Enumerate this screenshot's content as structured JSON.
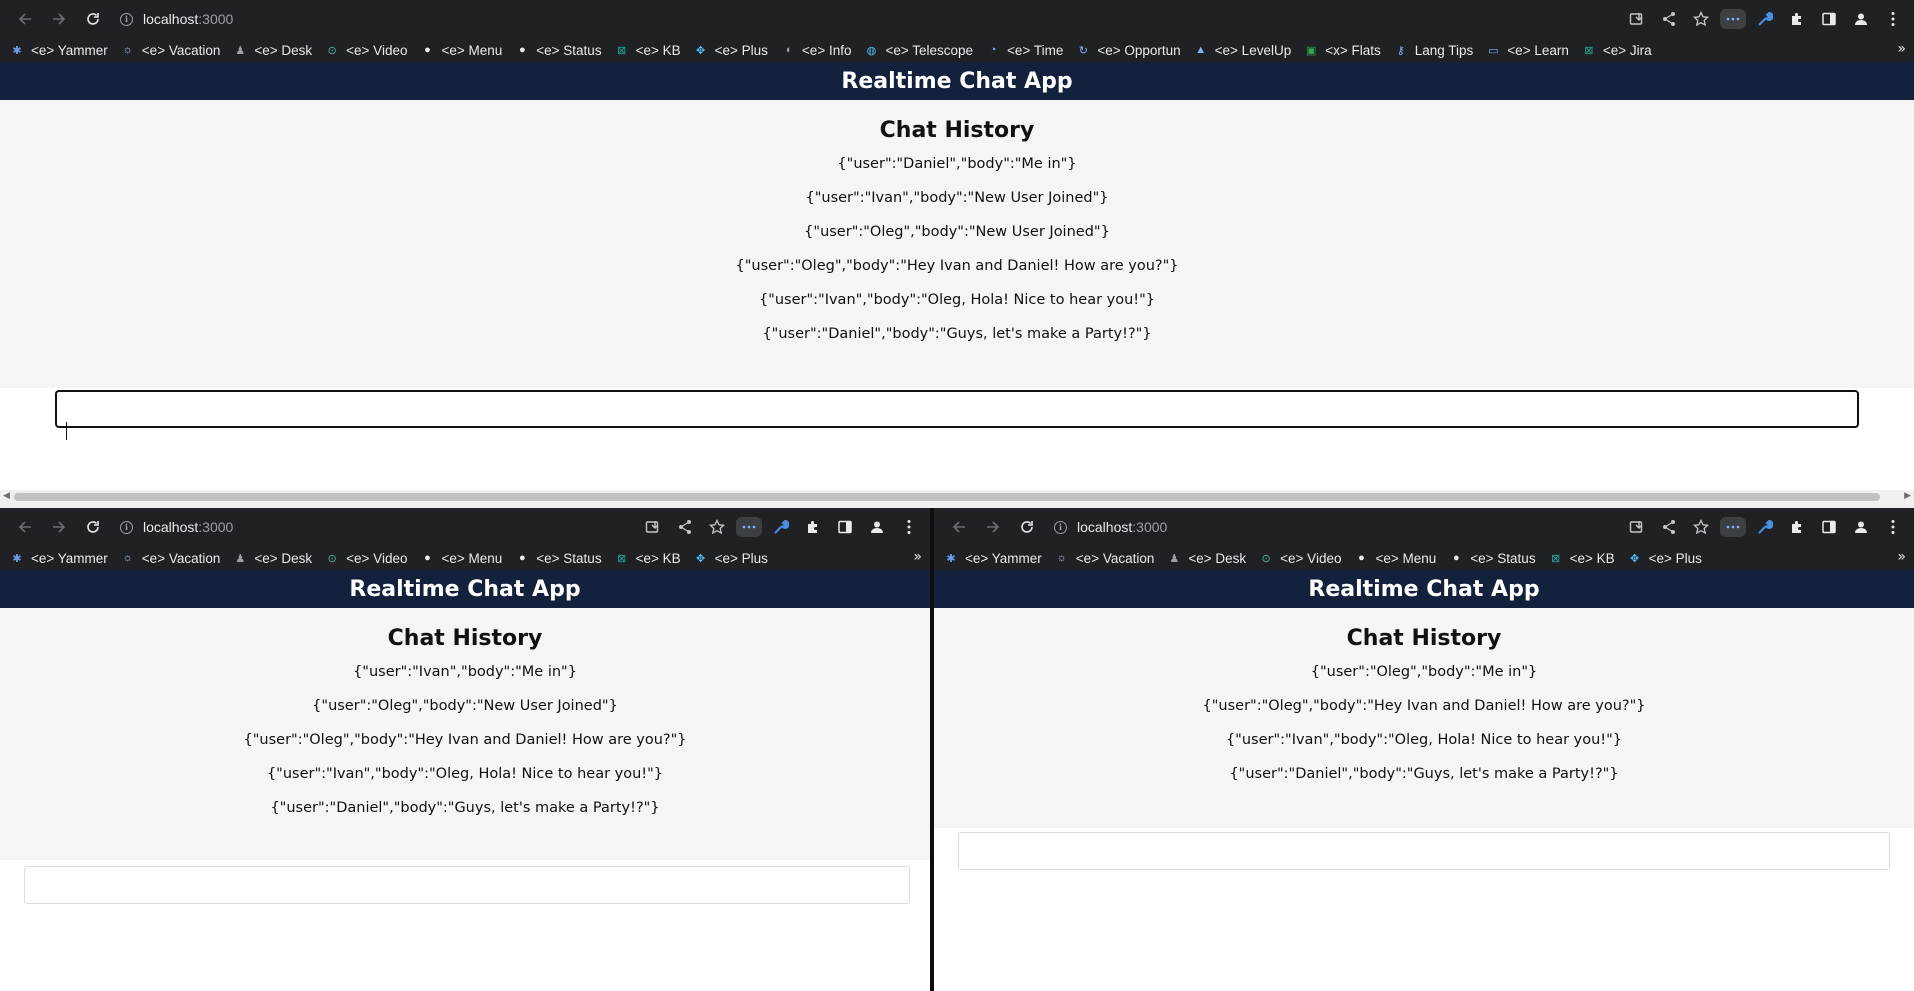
{
  "browser": {
    "url_host": "localhost",
    "url_port": ":3000",
    "icons": {
      "back": "arrow-left-icon",
      "forward": "arrow-right-icon",
      "reload": "reload-icon",
      "site_info": "info-icon",
      "install": "install-icon",
      "share": "share-icon",
      "bookmark": "star-icon",
      "extensions": "puzzle-icon",
      "side_panel": "side-panel-icon",
      "profile": "profile-icon",
      "menu": "kebab-menu-icon"
    },
    "bookmarks_full": [
      {
        "label": "<e> Yammer",
        "icon": "yammer-icon",
        "color": "#6d9eeb"
      },
      {
        "label": "<e> Vacation",
        "icon": "sun-icon",
        "color": "#a8c7fa"
      },
      {
        "label": "<e> Desk",
        "icon": "desk-icon",
        "color": "#9aa0a6"
      },
      {
        "label": "<e> Video",
        "icon": "play-icon",
        "color": "#5bb3a8"
      },
      {
        "label": "<e> Menu",
        "icon": "globe-icon",
        "color": "#e8eaed"
      },
      {
        "label": "<e> Status",
        "icon": "globe-icon",
        "color": "#e8eaed"
      },
      {
        "label": "<e> KB",
        "icon": "x-logo-icon",
        "color": "#26a69a"
      },
      {
        "label": "<e> Plus",
        "icon": "plus-icon",
        "color": "#4fc3f7"
      },
      {
        "label": "<e> Info",
        "icon": "info-bookmark-icon",
        "color": "#9aa0a6"
      },
      {
        "label": "<e> Telescope",
        "icon": "telescope-icon",
        "color": "#4fc3f7"
      },
      {
        "label": "<e> Time",
        "icon": "time-icon",
        "color": "#8ab4f8"
      },
      {
        "label": "<e> Opportun",
        "icon": "refresh-icon",
        "color": "#8ab4f8"
      },
      {
        "label": "<e> LevelUp",
        "icon": "levelup-icon",
        "color": "#8ab4f8"
      },
      {
        "label": "<x> Flats",
        "icon": "excel-icon",
        "color": "#34a853"
      },
      {
        "label": "Lang Tips",
        "icon": "key-icon",
        "color": "#8ab4f8"
      },
      {
        "label": "<e> Learn",
        "icon": "laptop-icon",
        "color": "#8ab4f8"
      },
      {
        "label": "<e> Jira",
        "icon": "x-logo-icon",
        "color": "#26a69a"
      }
    ],
    "bookmarks_more": "»"
  },
  "app": {
    "title": "Realtime Chat App",
    "history_heading": "Chat History",
    "input_value": ""
  },
  "windows": {
    "top": {
      "messages": [
        "{\"user\":\"Daniel\",\"body\":\"Me in\"}",
        "{\"user\":\"Ivan\",\"body\":\"New User Joined\"}",
        "{\"user\":\"Oleg\",\"body\":\"New User Joined\"}",
        "{\"user\":\"Oleg\",\"body\":\"Hey Ivan and Daniel! How are you?\"}",
        "{\"user\":\"Ivan\",\"body\":\"Oleg, Hola! Nice to hear you!\"}",
        "{\"user\":\"Daniel\",\"body\":\"Guys, let's make a Party!?\"}"
      ]
    },
    "bottom_left": {
      "messages": [
        "{\"user\":\"Ivan\",\"body\":\"Me in\"}",
        "{\"user\":\"Oleg\",\"body\":\"New User Joined\"}",
        "{\"user\":\"Oleg\",\"body\":\"Hey Ivan and Daniel! How are you?\"}",
        "{\"user\":\"Ivan\",\"body\":\"Oleg, Hola! Nice to hear you!\"}",
        "{\"user\":\"Daniel\",\"body\":\"Guys, let's make a Party!?\"}"
      ]
    },
    "bottom_right": {
      "messages": [
        "{\"user\":\"Oleg\",\"body\":\"Me in\"}",
        "{\"user\":\"Oleg\",\"body\":\"Hey Ivan and Daniel! How are you?\"}",
        "{\"user\":\"Ivan\",\"body\":\"Oleg, Hola! Nice to hear you!\"}",
        "{\"user\":\"Daniel\",\"body\":\"Guys, let's make a Party!?\"}"
      ]
    }
  },
  "colors": {
    "chrome_bg": "#202124",
    "app_header_bg": "#13213c",
    "history_bg": "#f5f5f5"
  }
}
